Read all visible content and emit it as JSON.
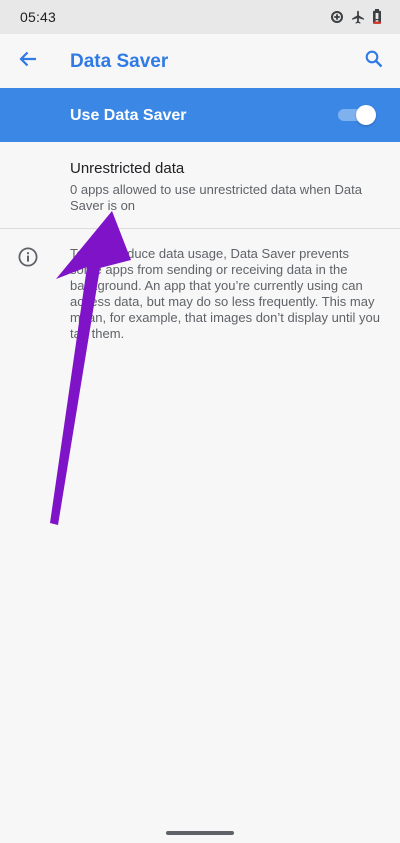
{
  "status_bar": {
    "time": "05:43",
    "icons": [
      "data-saver-icon",
      "airplane-mode-icon",
      "battery-low-icon"
    ]
  },
  "app_bar": {
    "title": "Data Saver",
    "back_icon": "arrow-back-icon",
    "search_icon": "search-icon"
  },
  "master_switch": {
    "label": "Use Data Saver",
    "checked": true
  },
  "unrestricted": {
    "title": "Unrestricted data",
    "summary": "0 apps allowed to use unrestricted data when Data Saver is on"
  },
  "footer": {
    "icon": "info-icon",
    "text": "To help reduce data usage, Data Saver prevents some apps from sending or receiving data in the background. An app that you’re currently using can access data, but may do so less frequently. This may mean, for example, that images don’t display until you tap them."
  },
  "colors": {
    "accent": "#2f7ae5",
    "switch_bar": "#3b87e6",
    "annotation_arrow": "#7f13c8"
  }
}
